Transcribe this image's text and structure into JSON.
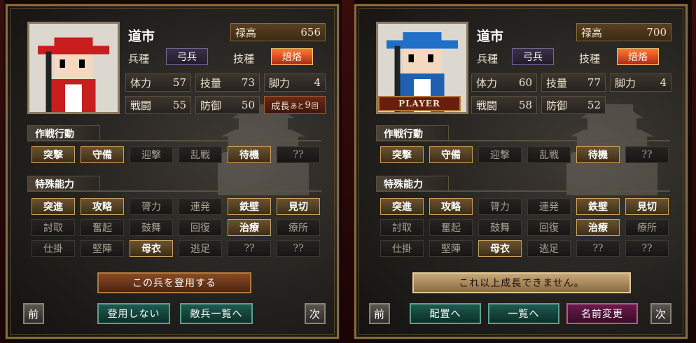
{
  "left": {
    "name": "道市",
    "salary": {
      "label": "禄高",
      "value": "656"
    },
    "unit_type": {
      "label": "兵種",
      "value": "弓兵"
    },
    "skill": {
      "label": "技種",
      "value": "焙烙"
    },
    "stats": {
      "hp": {
        "label": "体力",
        "value": "57"
      },
      "tech": {
        "label": "技量",
        "value": "73"
      },
      "leg": {
        "label": "脚力",
        "value": "4"
      },
      "battle": {
        "label": "戦闘",
        "value": "55"
      },
      "defense": {
        "label": "防御",
        "value": "50"
      }
    },
    "growth": {
      "label": "成長",
      "small": "あと",
      "value": "9",
      "unit": "回"
    },
    "tactics_title": "作戦行動",
    "tactics": [
      {
        "label": "突撃",
        "on": true
      },
      {
        "label": "守備",
        "on": true
      },
      {
        "label": "迎撃",
        "on": false
      },
      {
        "label": "乱戦",
        "on": false
      },
      {
        "label": "待機",
        "on": true
      },
      {
        "label": "??",
        "on": false
      }
    ],
    "abilities_title": "特殊能力",
    "abilities": [
      {
        "label": "突進",
        "on": true
      },
      {
        "label": "攻略",
        "on": true
      },
      {
        "label": "膂力",
        "on": false
      },
      {
        "label": "連発",
        "on": false
      },
      {
        "label": "鉄壁",
        "on": true
      },
      {
        "label": "見切",
        "on": true
      },
      {
        "label": "討取",
        "on": false
      },
      {
        "label": "奮起",
        "on": false
      },
      {
        "label": "鼓舞",
        "on": false
      },
      {
        "label": "回復",
        "on": false
      },
      {
        "label": "治療",
        "on": true
      },
      {
        "label": "療所",
        "on": false
      },
      {
        "label": "仕掛",
        "on": false
      },
      {
        "label": "堅陣",
        "on": false
      },
      {
        "label": "母衣",
        "on": true
      },
      {
        "label": "逃足",
        "on": false
      },
      {
        "label": "??",
        "on": false
      },
      {
        "label": "??",
        "on": false
      }
    ],
    "main_button": "この兵を登用する",
    "prev": "前",
    "next": "次",
    "btn1": "登用しない",
    "btn2": "敵兵一覧へ"
  },
  "right": {
    "name": "道市",
    "player_tag": "PLAYER",
    "salary": {
      "label": "禄高",
      "value": "700"
    },
    "unit_type": {
      "label": "兵種",
      "value": "弓兵"
    },
    "skill": {
      "label": "技種",
      "value": "焙烙"
    },
    "stats": {
      "hp": {
        "label": "体力",
        "value": "60"
      },
      "tech": {
        "label": "技量",
        "value": "77"
      },
      "leg": {
        "label": "脚力",
        "value": "4"
      },
      "battle": {
        "label": "戦闘",
        "value": "58"
      },
      "defense": {
        "label": "防御",
        "value": "52"
      }
    },
    "tactics_title": "作戦行動",
    "tactics": [
      {
        "label": "突撃",
        "on": true
      },
      {
        "label": "守備",
        "on": true
      },
      {
        "label": "迎撃",
        "on": false
      },
      {
        "label": "乱戦",
        "on": false
      },
      {
        "label": "待機",
        "on": true
      },
      {
        "label": "??",
        "on": false
      }
    ],
    "abilities_title": "特殊能力",
    "abilities": [
      {
        "label": "突進",
        "on": true
      },
      {
        "label": "攻略",
        "on": true
      },
      {
        "label": "膂力",
        "on": false
      },
      {
        "label": "連発",
        "on": false
      },
      {
        "label": "鉄壁",
        "on": true
      },
      {
        "label": "見切",
        "on": true
      },
      {
        "label": "討取",
        "on": false
      },
      {
        "label": "奮起",
        "on": false
      },
      {
        "label": "鼓舞",
        "on": false
      },
      {
        "label": "回復",
        "on": false
      },
      {
        "label": "治療",
        "on": true
      },
      {
        "label": "療所",
        "on": false
      },
      {
        "label": "仕掛",
        "on": false
      },
      {
        "label": "堅陣",
        "on": false
      },
      {
        "label": "母衣",
        "on": true
      },
      {
        "label": "逃足",
        "on": false
      },
      {
        "label": "??",
        "on": false
      },
      {
        "label": "??",
        "on": false
      }
    ],
    "main_button": "これ以上成長できません。",
    "prev": "前",
    "next": "次",
    "btn1": "配置へ",
    "btn2": "一覧へ",
    "btn3": "名前変更"
  },
  "colors": {
    "left_hat": "#c81e1e",
    "right_hat": "#2070c8",
    "left_robe": "#c81e1e",
    "right_robe": "#2060b0"
  }
}
